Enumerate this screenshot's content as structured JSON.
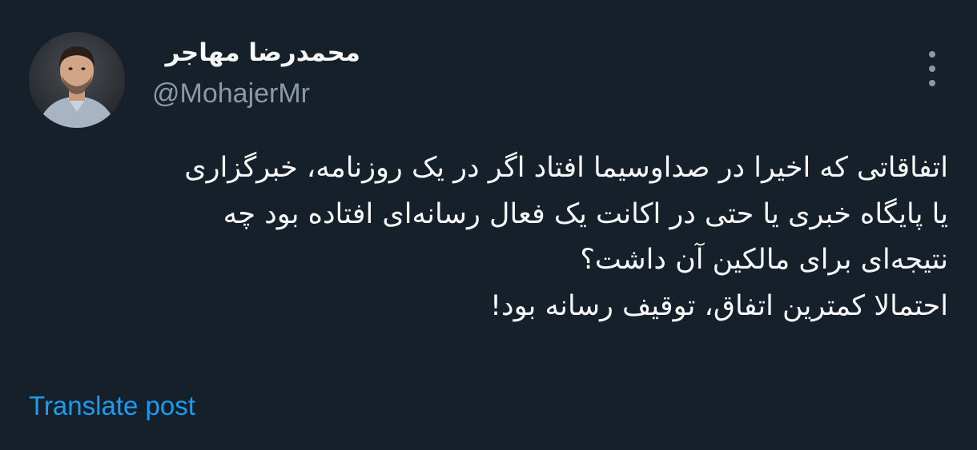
{
  "author": {
    "display_name": "محمدرضا مهاجر",
    "handle": "@MohajerMr",
    "avatar_icon": "profile-photo"
  },
  "actions": {
    "more_icon": "more-vertical-icon"
  },
  "post": {
    "lines": [
      "اتفاقاتی که اخیرا در صداوسیما افتاد اگر در یک روزنامه، خبرگزاری",
      "یا پایگاه خبری یا حتی در اکانت یک فعال رسانه‌ای افتاده بود چه",
      "نتیجه‌ای برای مالکین آن داشت؟",
      "احتمالا کمترین اتفاق، توقیف رسانه بود!"
    ],
    "translate_label": "Translate post"
  },
  "colors": {
    "background": "#15202b",
    "text_primary": "#f7f9f9",
    "text_secondary": "#8b98a5",
    "link": "#1d9bf0"
  }
}
